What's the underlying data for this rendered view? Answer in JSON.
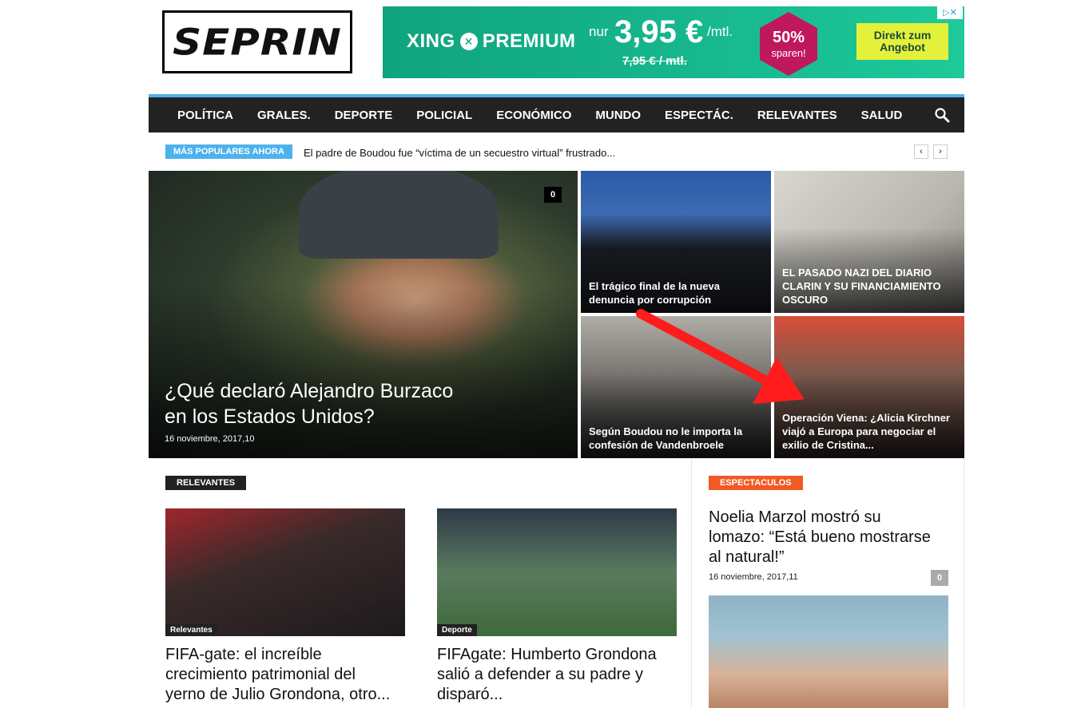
{
  "site": {
    "logo_text": "SEPRIN"
  },
  "ad": {
    "brand": "XING",
    "brand_suffix": "PREMIUM",
    "nur": "nur",
    "price": "3,95 €",
    "per": "/mtl.",
    "old_price": "7,95 € / mtl.",
    "discount": "50%",
    "discount_sub": "sparen!",
    "cta_line1": "Direkt zum",
    "cta_line2": "Angebot"
  },
  "nav": {
    "items": [
      "POLÍTICA",
      "GRALES.",
      "DEPORTE",
      "POLICIAL",
      "ECONÓMICO",
      "MUNDO",
      "ESPECTÁC.",
      "RELEVANTES",
      "SALUD"
    ]
  },
  "ticker": {
    "label": "MÁS POPULARES AHORA",
    "text": "El padre de Boudou fue “víctima de un secuestro virtual” frustrado...",
    "prev": "‹",
    "next": "›"
  },
  "featured": {
    "main": {
      "title_line1": "¿Qué declaró Alejandro Burzaco",
      "title_line2": "en los Estados Unidos?",
      "date": "16 noviembre, 2017,10",
      "comments": "0"
    },
    "tiles": [
      {
        "title_line1": "El trágico final de la nueva",
        "title_line2": "denuncia por corrupción"
      },
      {
        "title_line1": "EL PASADO NAZI DEL DIARIO",
        "title_line2": "CLARIN Y SU FINANCIAMIENTO",
        "title_line3": " OSCURO"
      },
      {
        "title_line1": "Según Boudou no le importa la",
        "title_line2": "confesión de Vandenbroele"
      },
      {
        "title_line1": "Operación Viena: ¿Alicia Kirchner",
        "title_line2": "viajó a Europa para negociar el",
        "title_line3": "exilio de Cristina..."
      }
    ]
  },
  "relevantes": {
    "label": "RELEVANTES",
    "cards": [
      {
        "tag": "Relevantes",
        "title_line1": "FIFA-gate: el increíble",
        "title_line2": "crecimiento patrimonial del",
        "title_line3": "yerno de Julio Grondona, otro..."
      },
      {
        "tag": "Deporte",
        "title_line1": "FIFAgate: Humberto Grondona",
        "title_line2": "salió a defender a su padre y",
        "title_line3": "disparó..."
      }
    ]
  },
  "espectaculos": {
    "label": "ESPECTACULOS",
    "title_line1": "Noelia Marzol mostró su",
    "title_line2": "lomazo: “Está bueno mostrarse",
    "title_line3": "al natural!”",
    "date": "16 noviembre, 2017,11",
    "comments": "0"
  },
  "colors": {
    "nav_bg": "#222222",
    "accent": "#4db2ec",
    "espectaculos": "#f15a24",
    "arrow": "#ff1c1c"
  }
}
